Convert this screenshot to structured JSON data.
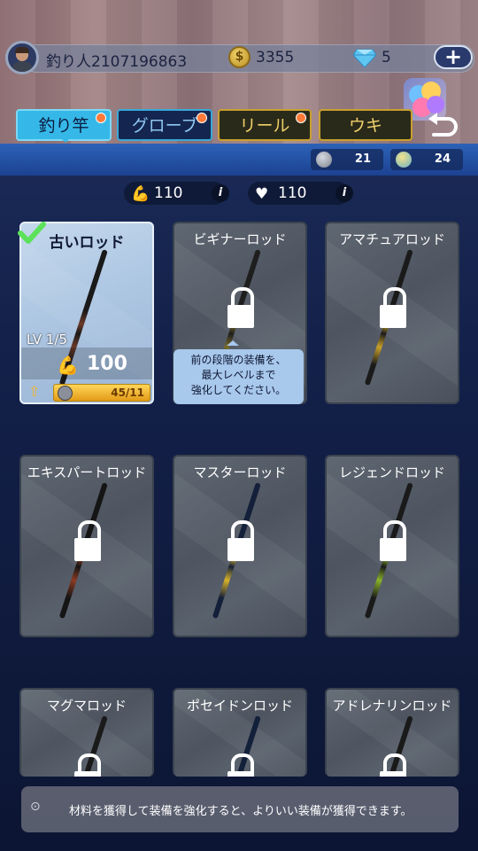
{
  "player": {
    "name": "釣り人2107196863",
    "coins": "3355",
    "coin_glyph": "$",
    "gems": "5",
    "add_label": "+"
  },
  "tabs": [
    {
      "label": "釣り竿",
      "badge": true,
      "selected": true
    },
    {
      "label": "グローブ",
      "badge": true
    },
    {
      "label": "リール",
      "badge": true
    },
    {
      "label": "ウキ",
      "badge": false
    }
  ],
  "resources": [
    {
      "icon": "ore-icon",
      "value": "21"
    },
    {
      "icon": "gem-orb-icon",
      "value": "24"
    }
  ],
  "stats": [
    {
      "icon": "arm-icon",
      "value": "110",
      "info": "i"
    },
    {
      "icon": "heart-icon",
      "value": "110",
      "info": "i"
    }
  ],
  "rods": [
    {
      "name": "古いロッド",
      "level": "LV 1/5",
      "attack": "100",
      "progress": "45/11",
      "progress_fraction": 1.0,
      "equipped": true,
      "locked": false,
      "colors": [
        "#1a1a1a",
        "#6b3a2a"
      ]
    },
    {
      "name": "ビギナーロッド",
      "locked": true,
      "colors": [
        "#1e1e1e",
        "#7a6a2a"
      ]
    },
    {
      "name": "アマチュアロッド",
      "locked": true,
      "colors": [
        "#1a1a1a",
        "#c8a12a"
      ]
    },
    {
      "name": "エキスパートロッド",
      "locked": true,
      "colors": [
        "#151515",
        "#8a3a22"
      ]
    },
    {
      "name": "マスターロッド",
      "locked": true,
      "colors": [
        "#14203a",
        "#d8b22a"
      ]
    },
    {
      "name": "レジェンドロッド",
      "locked": true,
      "colors": [
        "#1a1a1a",
        "#8ab22a"
      ]
    },
    {
      "name": "マグマロッド",
      "locked": true,
      "colors": [
        "#1a1a1a",
        "#d0a020"
      ]
    },
    {
      "name": "ポセイドンロッド",
      "locked": true,
      "colors": [
        "#12203a",
        "#d8b22a"
      ]
    },
    {
      "name": "アドレナリンロッド",
      "locked": true,
      "colors": [
        "#1a1a1a",
        "#b02a2a"
      ]
    }
  ],
  "tooltip": {
    "lines": [
      "前の段階の装備を、",
      "最大レベルまで",
      "強化してください。"
    ]
  },
  "hint": {
    "icon_text": "⊙",
    "text": "材料を獲得して装備を強化すると、よりいい装備が獲得できます。"
  },
  "colors": {
    "accent": "#35b8e8",
    "gold": "#c9a02e",
    "band": "#2d62b8"
  }
}
